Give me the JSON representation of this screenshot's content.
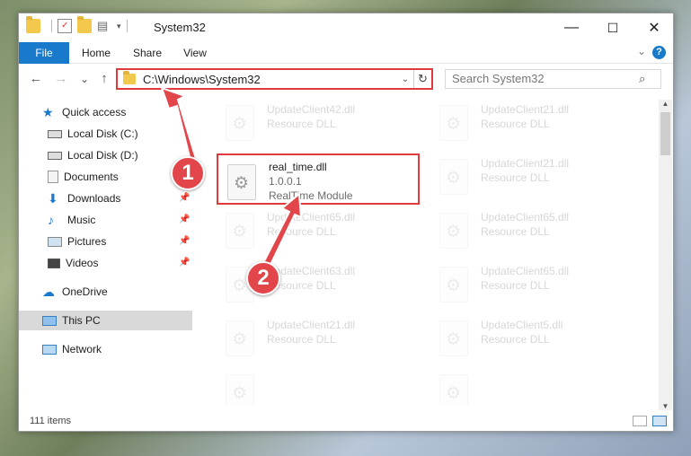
{
  "titlebar": {
    "title": "System32",
    "minimize": "—",
    "maximize": "☐",
    "close": "✕"
  },
  "ribbon": {
    "tabs": [
      {
        "label": "File"
      },
      {
        "label": "Home"
      },
      {
        "label": "Share"
      },
      {
        "label": "View"
      }
    ],
    "help": "?"
  },
  "address": {
    "back": "←",
    "forward": "→",
    "recent": "⌄",
    "up": "↑",
    "path": "C:\\Windows\\System32",
    "refresh": "↻",
    "search_placeholder": "Search System32"
  },
  "sidebar": {
    "items": [
      {
        "label": "Quick access"
      },
      {
        "label": "Local Disk (C:)"
      },
      {
        "label": "Local Disk (D:)"
      },
      {
        "label": "Documents"
      },
      {
        "label": "Downloads"
      },
      {
        "label": "Music"
      },
      {
        "label": "Pictures"
      },
      {
        "label": "Videos"
      },
      {
        "label": "OneDrive"
      },
      {
        "label": "This PC"
      },
      {
        "label": "Network"
      }
    ]
  },
  "files": [
    {
      "name": "UpdateClient42.dll",
      "desc": "Resource DLL"
    },
    {
      "name": "UpdateClient21.dll",
      "desc": "Resource DLL"
    },
    {
      "name": "real_time.dll",
      "version": "1.0.0.1",
      "desc": "RealTime Module"
    },
    {
      "name": "UpdateClient21.dll",
      "desc": "Resource DLL"
    },
    {
      "name": "UpdateClient65.dll",
      "desc": "Resource DLL"
    },
    {
      "name": "UpdateClient65.dll",
      "desc": "Resource DLL"
    },
    {
      "name": "UpdateClient63.dll",
      "desc": "Resource DLL"
    },
    {
      "name": "UpdateClient65.dll",
      "desc": "Resource DLL"
    },
    {
      "name": "UpdateClient21.dll",
      "desc": "Resource DLL"
    },
    {
      "name": "UpdateClient5.dll",
      "desc": "Resource DLL"
    }
  ],
  "status": {
    "item_count": "111 items"
  },
  "annotations": {
    "step1": "1",
    "step2": "2"
  },
  "colors": {
    "accent": "#1979ca",
    "highlight": "#e0393e",
    "badge": "#e2454a"
  }
}
